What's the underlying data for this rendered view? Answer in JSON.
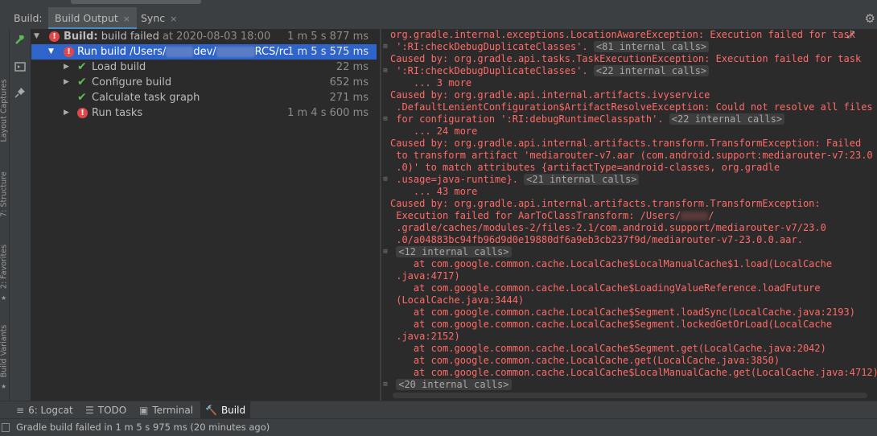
{
  "tabs": {
    "label": "Build:",
    "build_output": "Build Output",
    "sync": "Sync",
    "close_glyph": "×"
  },
  "side_labels": {
    "layout_captures": "Layout Captures",
    "structure": "7: Structure",
    "favorites": "2: Favorites",
    "build_variants": "Build Variants"
  },
  "tree": {
    "root": {
      "title": "Build:",
      "text": " build failed",
      "timestamp": " at 2020-08-03 18:00",
      "time": "1 m 5 s 877 ms"
    },
    "run": {
      "prefix": "Run build /Users/",
      "mid": "dev/",
      "suffix": "RCS/rc",
      "time": "1 m 5 s 575 ms"
    },
    "children": [
      {
        "label": "Load build",
        "time": "22 ms",
        "status": "ok"
      },
      {
        "label": "Configure build",
        "time": "652 ms",
        "status": "ok"
      },
      {
        "label": "Calculate task graph",
        "time": "271 ms",
        "status": "ok"
      },
      {
        "label": "Run tasks",
        "time": "1 m 4 s 600 ms",
        "status": "error"
      }
    ]
  },
  "console": {
    "l1": "org.gradle.internal.exceptions.LocationAwareException: Execution failed for task",
    "l2": " ':RI:checkDebugDuplicateClasses'.",
    "l2c": "<81 internal calls>",
    "l3": "Caused by: org.gradle.api.tasks.TaskExecutionException: Execution failed for task",
    "l4": " ':RI:checkDebugDuplicateClasses'.",
    "l4c": "<22 internal calls>",
    "l5": "    ... 3 more",
    "l6": "Caused by: org.gradle.api.internal.artifacts.ivyservice",
    "l7": " .DefaultLenientConfiguration$ArtifactResolveException: Could not resolve all files",
    "l8": " for configuration ':RI:debugRuntimeClasspath'.",
    "l8c": "<22 internal calls>",
    "l9": "    ... 24 more",
    "l10": "Caused by: org.gradle.api.internal.artifacts.transform.TransformException: Failed",
    "l11": " to transform artifact 'mediarouter-v7.aar (com.android.support:mediarouter-v7:23.0",
    "l12": " .0)' to match attributes {artifactType=android-classes, org.gradle",
    "l13": " .usage=java-runtime}.",
    "l13c": "<21 internal calls>",
    "l14": "    ... 43 more",
    "l15": "Caused by: org.gradle.api.internal.artifacts.transform.TransformException:",
    "l16": " Execution failed for AarToClassTransform: /Users/",
    "l16b": "/",
    "l17": " .gradle/caches/modules-2/files-2.1/com.android.support/mediarouter-v7/23.0",
    "l18": " .0/a04883bc94fb96d9d0e19880df6a9eb3cb237f9d/mediarouter-v7-23.0.0.aar.",
    "l19c": "<12 internal calls>",
    "l20": "    at com.google.common.cache.LocalCache$LocalManualCache$1.load(LocalCache",
    "l21": " .java:4717)",
    "l22": "    at com.google.common.cache.LocalCache$LoadingValueReference.loadFuture",
    "l23": " (LocalCache.java:3444)",
    "l24": "    at com.google.common.cache.LocalCache$Segment.loadSync(LocalCache.java:2193)",
    "l25": "    at com.google.common.cache.LocalCache$Segment.lockedGetOrLoad(LocalCache",
    "l26": " .java:2152)",
    "l27": "    at com.google.common.cache.LocalCache$Segment.get(LocalCache.java:2042)",
    "l28": "    at com.google.common.cache.LocalCache.get(LocalCache.java:3850)",
    "l29": "    at com.google.common.cache.LocalCache$LocalManualCache.get(LocalCache.java:4712)",
    "l30c": "<20 internal calls>"
  },
  "bottom_tabs": {
    "logcat": "6: Logcat",
    "todo": "TODO",
    "terminal": "Terminal",
    "build": "Build"
  },
  "status": {
    "text": "Gradle build failed in 1 m 5 s 975 ms (20 minutes ago)"
  },
  "colors": {
    "error_text": "#ff6b68",
    "selection": "#2f65ca",
    "success": "#5fb85a",
    "error_badge": "#e0474b"
  }
}
